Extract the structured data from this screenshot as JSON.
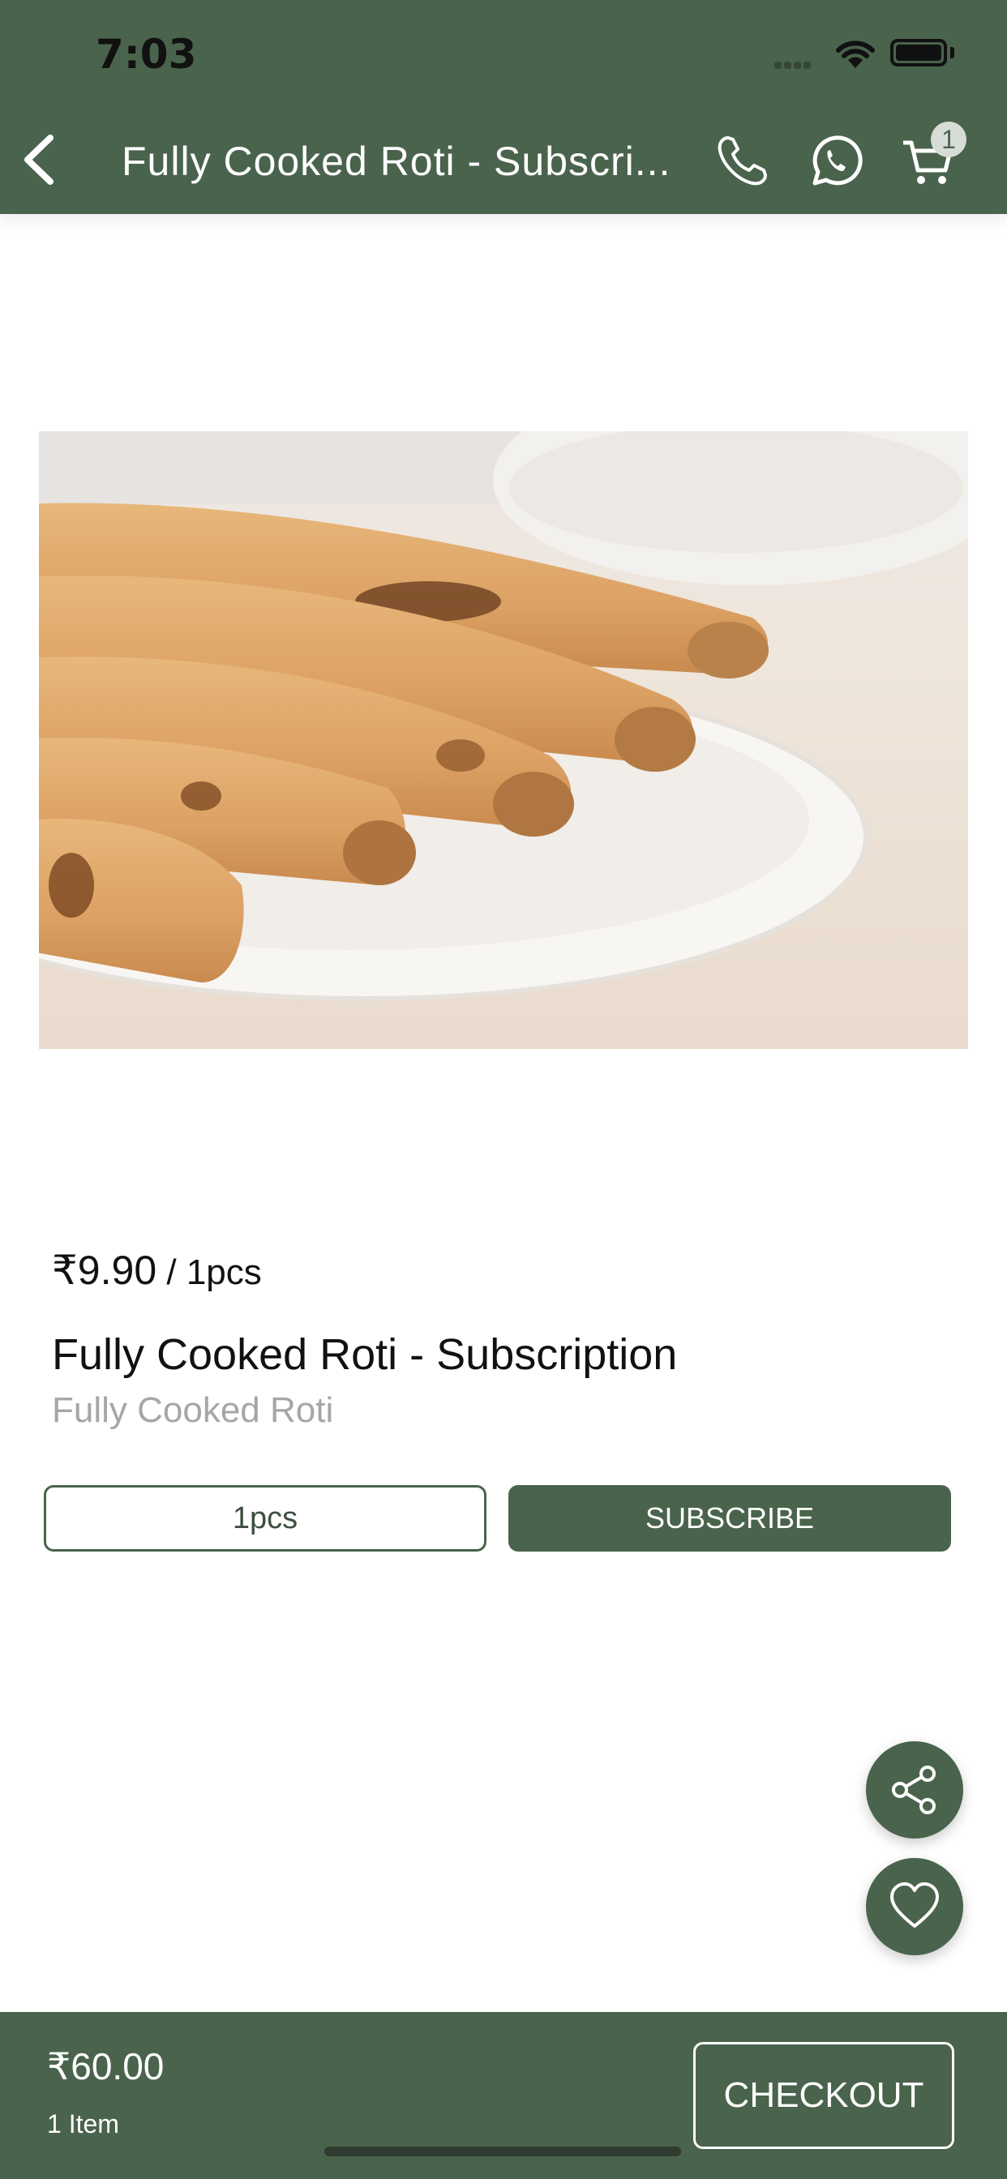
{
  "status_bar": {
    "time": "7:03"
  },
  "nav": {
    "title": "Fully Cooked Roti - Subscri...",
    "cart_count": "1"
  },
  "product": {
    "price": "₹9.90",
    "unit": " / 1pcs",
    "name": "Fully Cooked Roti - Subscription",
    "subtitle": "Fully Cooked Roti",
    "quantity_option": "1pcs",
    "subscribe_label": "SUBSCRIBE"
  },
  "footer": {
    "total": "₹60.00",
    "items": "1 Item",
    "checkout_label": "CHECKOUT"
  },
  "colors": {
    "primary": "#4a634c",
    "white": "#ffffff",
    "muted_text": "#a6a6a6"
  },
  "icons": [
    "back-arrow-icon",
    "phone-icon",
    "whatsapp-icon",
    "cart-icon",
    "share-icon",
    "heart-icon"
  ]
}
